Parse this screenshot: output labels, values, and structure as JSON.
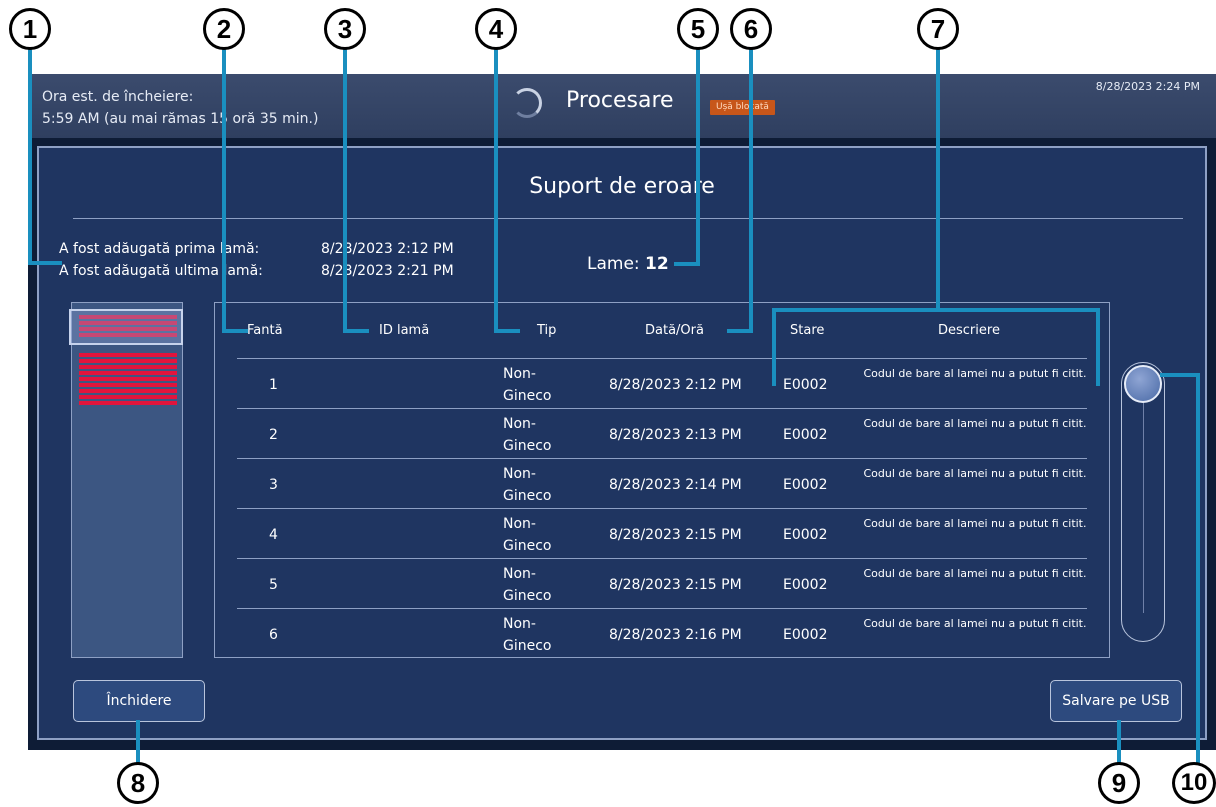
{
  "topbar": {
    "eta_label": "Ora est. de încheiere:",
    "eta_value": "5:59 AM (au mai rămas 15 oră 35 min.)",
    "status": "Procesare",
    "lock_badge": "Ușă blocată",
    "clock": "8/28/2023 2:24 PM"
  },
  "dialog": {
    "title": "Suport de eroare",
    "first_slide_label": "A fost adăugată prima lamă:",
    "first_slide_time": "8/28/2023 2:12 PM",
    "last_slide_label": "A fost adăugată ultima lamă:",
    "last_slide_time": "8/28/2023 2:21 PM",
    "count_label": "Lame:",
    "count_value": "12"
  },
  "rack": {
    "filled_slot_color": "#e1143c",
    "visible_filled_slots": 9
  },
  "table": {
    "columns": {
      "slot": "Fantă",
      "slide_id": "ID lamă",
      "type": "Tip",
      "datetime": "Dată/Oră",
      "status": "Stare",
      "description": "Descriere"
    },
    "rows": [
      {
        "slot": "1",
        "type": "Non-Gineco",
        "datetime": "8/28/2023 2:12 PM",
        "status": "E0002",
        "description": "Codul de bare al lamei nu a putut fi citit."
      },
      {
        "slot": "2",
        "type": "Non-Gineco",
        "datetime": "8/28/2023 2:13 PM",
        "status": "E0002",
        "description": "Codul de bare al lamei nu a putut fi citit."
      },
      {
        "slot": "3",
        "type": "Non-Gineco",
        "datetime": "8/28/2023 2:14 PM",
        "status": "E0002",
        "description": "Codul de bare al lamei nu a putut fi citit."
      },
      {
        "slot": "4",
        "type": "Non-Gineco",
        "datetime": "8/28/2023 2:15 PM",
        "status": "E0002",
        "description": "Codul de bare al lamei nu a putut fi citit."
      },
      {
        "slot": "5",
        "type": "Non-Gineco",
        "datetime": "8/28/2023 2:15 PM",
        "status": "E0002",
        "description": "Codul de bare al lamei nu a putut fi citit."
      },
      {
        "slot": "6",
        "type": "Non-Gineco",
        "datetime": "8/28/2023 2:16 PM",
        "status": "E0002",
        "description": "Codul de bare al lamei nu a putut fi citit."
      }
    ]
  },
  "buttons": {
    "close": "Închidere",
    "save_usb": "Salvare pe USB"
  },
  "callouts": [
    "1",
    "2",
    "3",
    "4",
    "5",
    "6",
    "7",
    "8",
    "9",
    "10"
  ],
  "colors": {
    "callout_line": "#1a8fbf",
    "screen_bg": "#0e1c36",
    "dialog_bg": "#1f3561",
    "badge": "#c7561a"
  }
}
